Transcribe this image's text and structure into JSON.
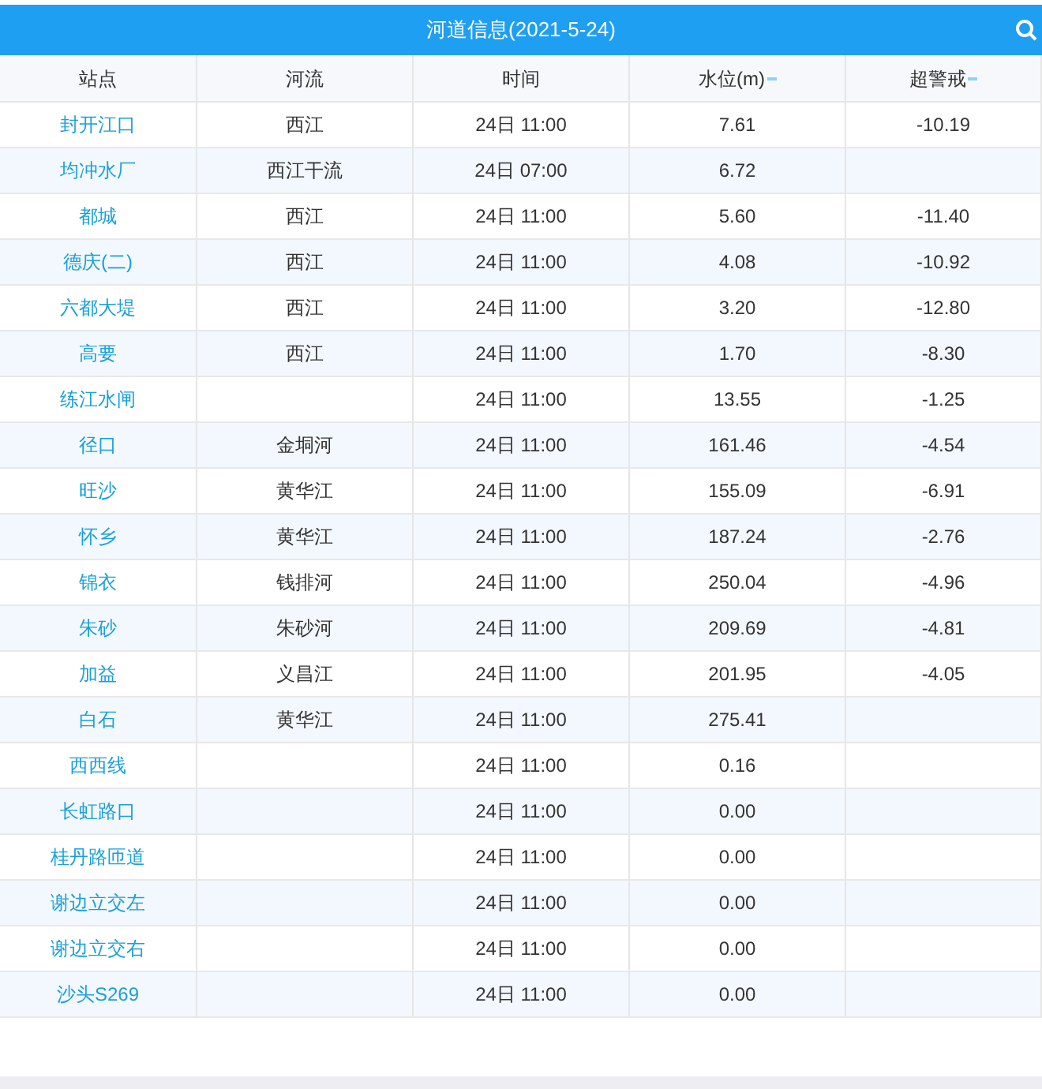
{
  "header": {
    "title": "河道信息(2021-5-24)"
  },
  "table": {
    "columns": [
      {
        "label": "站点",
        "sortable": false
      },
      {
        "label": "河流",
        "sortable": false
      },
      {
        "label": "时间",
        "sortable": false
      },
      {
        "label": "水位(m)",
        "sortable": true
      },
      {
        "label": "超警戒",
        "sortable": true
      }
    ],
    "rows": [
      [
        "封开江口",
        "西江",
        "24日 11:00",
        "7.61",
        "-10.19"
      ],
      [
        "均冲水厂",
        "西江干流",
        "24日 07:00",
        "6.72",
        ""
      ],
      [
        "都城",
        "西江",
        "24日 11:00",
        "5.60",
        "-11.40"
      ],
      [
        "德庆(二)",
        "西江",
        "24日 11:00",
        "4.08",
        "-10.92"
      ],
      [
        "六都大堤",
        "西江",
        "24日 11:00",
        "3.20",
        "-12.80"
      ],
      [
        "高要",
        "西江",
        "24日 11:00",
        "1.70",
        "-8.30"
      ],
      [
        "练江水闸",
        "",
        "24日 11:00",
        "13.55",
        "-1.25"
      ],
      [
        "径口",
        "金垌河",
        "24日 11:00",
        "161.46",
        "-4.54"
      ],
      [
        "旺沙",
        "黄华江",
        "24日 11:00",
        "155.09",
        "-6.91"
      ],
      [
        "怀乡",
        "黄华江",
        "24日 11:00",
        "187.24",
        "-2.76"
      ],
      [
        "锦衣",
        "钱排河",
        "24日 11:00",
        "250.04",
        "-4.96"
      ],
      [
        "朱砂",
        "朱砂河",
        "24日 11:00",
        "209.69",
        "-4.81"
      ],
      [
        "加益",
        "义昌江",
        "24日 11:00",
        "201.95",
        "-4.05"
      ],
      [
        "白石",
        "黄华江",
        "24日 11:00",
        "275.41",
        ""
      ],
      [
        "西西线",
        "",
        "24日 11:00",
        "0.16",
        ""
      ],
      [
        "长虹路口",
        "",
        "24日 11:00",
        "0.00",
        ""
      ],
      [
        "桂丹路匝道",
        "",
        "24日 11:00",
        "0.00",
        ""
      ],
      [
        "谢边立交左",
        "",
        "24日 11:00",
        "0.00",
        ""
      ],
      [
        "谢边立交右",
        "",
        "24日 11:00",
        "0.00",
        ""
      ],
      [
        "沙头S269",
        "",
        "24日 11:00",
        "0.00",
        ""
      ]
    ]
  }
}
